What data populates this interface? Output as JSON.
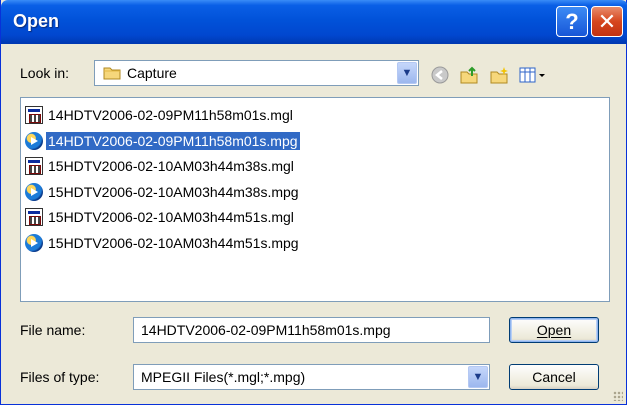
{
  "window": {
    "title": "Open"
  },
  "titlebar": {
    "help_glyph": "?",
    "close_glyph": "✕"
  },
  "lookin": {
    "label": "Look in:",
    "value": "Capture",
    "icons": [
      "back-icon",
      "up-folder-icon",
      "new-folder-icon",
      "view-menu-icon"
    ]
  },
  "files": [
    {
      "name": "14HDTV2006-02-09PM11h58m01s.mgl",
      "type": "mgl",
      "selected": false
    },
    {
      "name": "14HDTV2006-02-09PM11h58m01s.mpg",
      "type": "mpg",
      "selected": true
    },
    {
      "name": "15HDTV2006-02-10AM03h44m38s.mgl",
      "type": "mgl",
      "selected": false
    },
    {
      "name": "15HDTV2006-02-10AM03h44m38s.mpg",
      "type": "mpg",
      "selected": false
    },
    {
      "name": "15HDTV2006-02-10AM03h44m51s.mgl",
      "type": "mgl",
      "selected": false
    },
    {
      "name": "15HDTV2006-02-10AM03h44m51s.mpg",
      "type": "mpg",
      "selected": false
    }
  ],
  "filename": {
    "label": "File name:",
    "value": "14HDTV2006-02-09PM11h58m01s.mpg"
  },
  "filetype": {
    "label": "Files of type:",
    "value": "MPEGII Files(*.mgl;*.mpg)"
  },
  "buttons": {
    "open": "Open",
    "cancel": "Cancel"
  }
}
